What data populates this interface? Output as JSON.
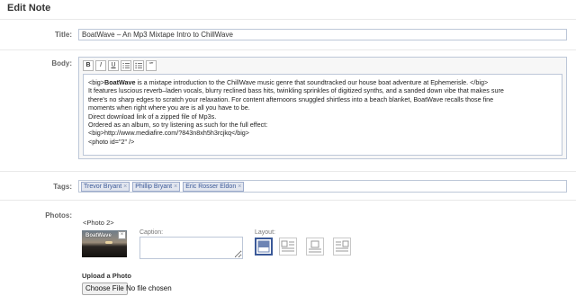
{
  "page": {
    "title": "Edit Note"
  },
  "labels": {
    "title": "Title:",
    "body": "Body:",
    "tags": "Tags:",
    "photos": "Photos:"
  },
  "note": {
    "title": "BoatWave – An Mp3 Mixtape Intro to ChillWave",
    "body_lines": [
      {
        "pre": "<big>",
        "bold": "BoatWave",
        "post": " is a mixtape introduction to the ChillWave music genre that soundtracked our house boat adventure at Ephemerisle. </big>"
      },
      {
        "pre": "It features luscious reverb–laden vocals, blurry reclined bass hits, twinkling sprinkles of digitized synths, and a sanded down vibe that makes sure",
        "bold": "",
        "post": ""
      },
      {
        "pre": "there's no sharp edges to scratch your relaxation. For content afternoons snuggled shirtless into a beach blanket, BoatWave recalls those fine",
        "bold": "",
        "post": ""
      },
      {
        "pre": "moments when right where you are is all you have to be.",
        "bold": "",
        "post": ""
      },
      {
        "pre": "Direct download link of a zipped file of Mp3s.",
        "bold": "",
        "post": ""
      },
      {
        "pre": "Ordered as an album, so try listening as such for the full effect:",
        "bold": "",
        "post": ""
      },
      {
        "pre": "<big>http://www.mediafire.com/?843n8xh5h3rcjkq</big>",
        "bold": "",
        "post": ""
      },
      {
        "pre": "<photo id=\"2\" />",
        "bold": "",
        "post": ""
      }
    ]
  },
  "toolbar": {
    "bold": "B",
    "italic": "I",
    "underline": "U",
    "quote": "“”"
  },
  "tags": [
    "Trevor Bryant",
    "Phillip Bryant",
    "Eric Rosser Eldon"
  ],
  "tag_remove_glyph": "×",
  "photos": {
    "ref": "<Photo 2>",
    "thumb_logo": "BoatWave",
    "remove_glyph": "×",
    "caption_label": "Caption:",
    "caption_value": "",
    "layout_label": "Layout:",
    "layout_options": [
      "full",
      "left",
      "center",
      "right"
    ],
    "layout_selected": "full"
  },
  "upload": {
    "label": "Upload a Photo",
    "button": "Choose File",
    "status": "No file chosen"
  },
  "colors": {
    "accent": "#3b5998",
    "border": "#bdc7d8",
    "tag_bg": "#e2e6ef"
  }
}
